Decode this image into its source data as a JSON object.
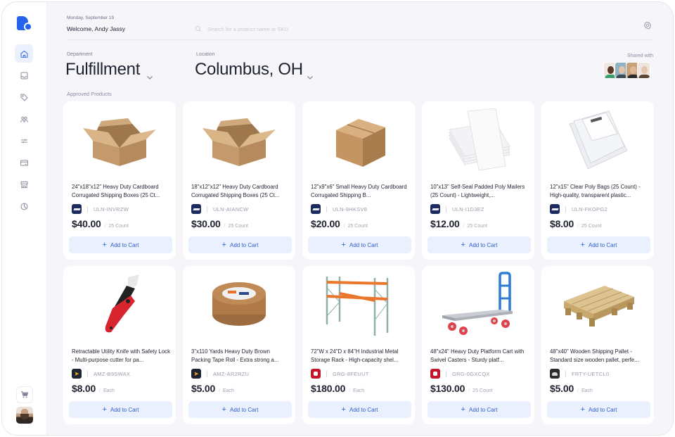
{
  "header": {
    "date": "Monday, September 19",
    "welcome": "Welcome, Andy Jassy",
    "search_placeholder": "Search for a product name or SKU"
  },
  "sidebar": {
    "items": [
      {
        "name": "home",
        "active": true
      },
      {
        "name": "inbox",
        "active": false
      },
      {
        "name": "tag",
        "active": false
      },
      {
        "name": "team",
        "active": false
      },
      {
        "name": "sliders",
        "active": false
      },
      {
        "name": "card",
        "active": false
      },
      {
        "name": "store",
        "active": false
      },
      {
        "name": "pie-chart",
        "active": false
      }
    ]
  },
  "filters": {
    "department_label": "Department",
    "department_value": "Fulfillment",
    "location_label": "Location",
    "location_value": "Columbus, OH"
  },
  "shared": {
    "label": "Shared with",
    "count": 4
  },
  "section_label": "Approved Products",
  "add_to_cart_label": "Add to Cart",
  "products": [
    {
      "title": "24\"x18\"x12\" Heavy Duty Cardboard Corrugated Shipping Boxes (25 Ct...",
      "brand": "uline",
      "sku": "ULN-INVRZW",
      "price": "$40.00",
      "unit": "25 Count",
      "image": "open-box"
    },
    {
      "title": "18\"x12\"x12\" Heavy Duty Cardboard Corrugated Shipping Boxes (25 Ct...",
      "brand": "uline",
      "sku": "ULN-AIANCW",
      "price": "$30.00",
      "unit": "25 Count",
      "image": "open-box"
    },
    {
      "title": "12\"x9\"x6\" Small Heavy Duty Cardboard Corrugated Shipping B...",
      "brand": "uline",
      "sku": "ULN-9HKSV8",
      "price": "$20.00",
      "unit": "25 Count",
      "image": "closed-box"
    },
    {
      "title": "10\"x13\" Self-Seal Padded Poly Mailers (25 Count) - Lightweight,...",
      "brand": "uline",
      "sku": "ULN-I1D3EZ",
      "price": "$12.00",
      "unit": "25 Count",
      "image": "mailers"
    },
    {
      "title": "12\"x15\" Clear Poly Bags (25 Count) - High-quality, transparent plastic...",
      "brand": "uline",
      "sku": "ULN-FKOPG2",
      "price": "$8.00",
      "unit": "25 Count",
      "image": "poly-bags"
    },
    {
      "title": "Retractable Utility Knife with Safety Lock - Multi-purpose cutter for pa...",
      "brand": "amz",
      "sku": "AMZ-B9SWAX",
      "price": "$8.00",
      "unit": "Each",
      "image": "knife"
    },
    {
      "title": "3\"x110 Yards Heavy Duty Brown Packing Tape Roll - Extra strong a...",
      "brand": "amz",
      "sku": "AMZ-AR2RZU",
      "price": "$5.00",
      "unit": "Each",
      "image": "tape"
    },
    {
      "title": "72\"W x 24\"D x 84\"H Industrial Metal Storage Rack - High-capacity shel...",
      "brand": "grg",
      "sku": "GRG-8FEUUT",
      "price": "$180.00",
      "unit": "Each",
      "image": "rack"
    },
    {
      "title": "48\"x24\" Heavy Duty Platform Cart with Swivel Casters - Sturdy platf...",
      "brand": "grg",
      "sku": "GRG-0GXCQX",
      "price": "$130.00",
      "unit": "25 Count",
      "image": "cart"
    },
    {
      "title": "48\"x40\" Wooden Shipping Pallet - Standard size wooden pallet, perfe...",
      "brand": "frty",
      "sku": "FRTY-UETCL0",
      "price": "$5.00",
      "unit": "Each",
      "image": "pallet"
    }
  ],
  "colors": {
    "accent": "#2563eb",
    "button_bg": "#eaf0fd",
    "button_text": "#2f5fd0",
    "background": "#f5f5fa"
  }
}
